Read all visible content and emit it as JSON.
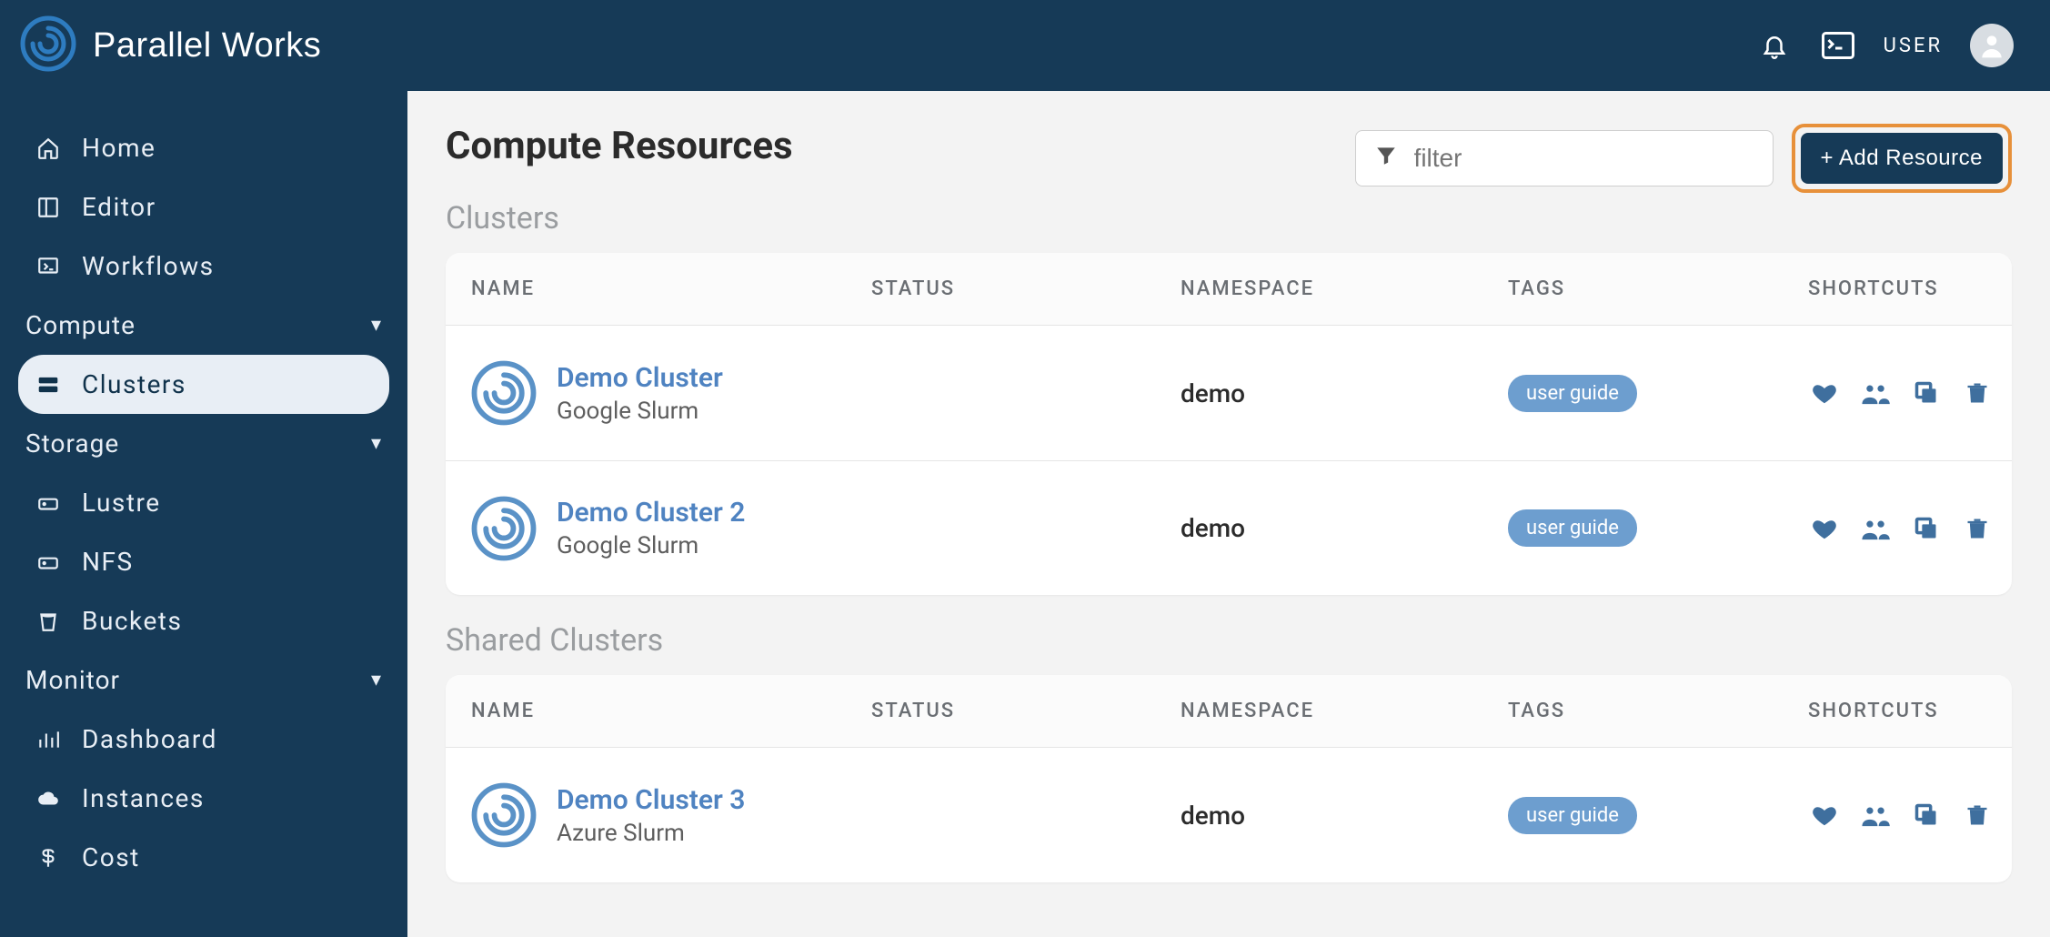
{
  "brand": {
    "name": "Parallel Works"
  },
  "topbar": {
    "user_label": "USER"
  },
  "sidebar": {
    "items_top": [
      {
        "label": "Home"
      },
      {
        "label": "Editor"
      },
      {
        "label": "Workflows"
      }
    ],
    "sections": [
      {
        "label": "Compute",
        "items": [
          {
            "label": "Clusters",
            "selected": true
          }
        ]
      },
      {
        "label": "Storage",
        "items": [
          {
            "label": "Lustre"
          },
          {
            "label": "NFS"
          },
          {
            "label": "Buckets"
          }
        ]
      },
      {
        "label": "Monitor",
        "items": [
          {
            "label": "Dashboard"
          },
          {
            "label": "Instances"
          },
          {
            "label": "Cost"
          }
        ]
      }
    ]
  },
  "page": {
    "title": "Compute Resources",
    "filter_placeholder": "filter",
    "add_button": "+ Add Resource"
  },
  "tables": {
    "headers": {
      "name": "NAME",
      "status": "STATUS",
      "namespace": "NAMESPACE",
      "tags": "TAGS",
      "shortcuts": "SHORTCUTS"
    },
    "sections": [
      {
        "title": "Clusters",
        "rows": [
          {
            "title": "Demo Cluster",
            "subtitle": "Google Slurm",
            "namespace": "demo",
            "tag": "user guide"
          },
          {
            "title": "Demo Cluster 2",
            "subtitle": "Google Slurm",
            "namespace": "demo",
            "tag": "user guide"
          }
        ]
      },
      {
        "title": "Shared Clusters",
        "rows": [
          {
            "title": "Demo Cluster 3",
            "subtitle": "Azure Slurm",
            "namespace": "demo",
            "tag": "user guide"
          }
        ]
      }
    ]
  }
}
